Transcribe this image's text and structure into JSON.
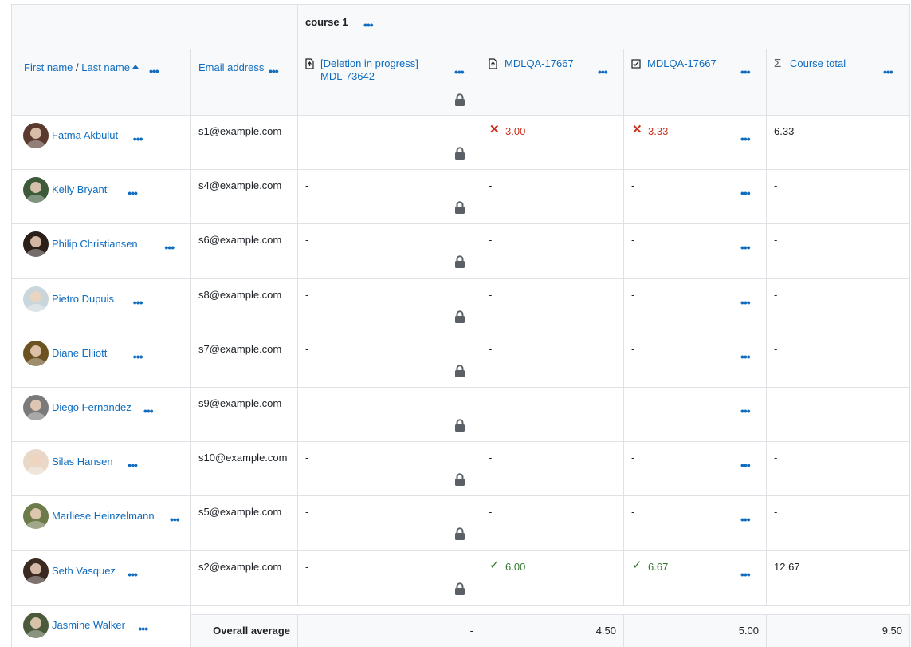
{
  "header": {
    "category_label": "course 1",
    "col_firstname": "First name",
    "name_separator": " / ",
    "col_lastname": "Last name",
    "col_email": "Email address",
    "col_item1_line1": "[Deletion in progress]",
    "col_item1_line2": "MDL-73642",
    "col_item2": "MDLQA-17667",
    "col_item3": "MDLQA-17667",
    "col_total": "Course total",
    "more_glyph": "•••"
  },
  "rows": [
    {
      "name": "Fatma Akbulut",
      "email": "s1@example.com",
      "item1": "-",
      "item2": "3.00",
      "item2_status": "incorrect",
      "item3": "3.33",
      "item3_status": "incorrect",
      "total": "6.33",
      "avatar_color": "#5a3a2e"
    },
    {
      "name": "Kelly Bryant",
      "email": "s4@example.com",
      "item1": "-",
      "item2": "-",
      "item2_status": "none",
      "item3": "-",
      "item3_status": "none",
      "total": "-",
      "avatar_color": "#3d5a3a"
    },
    {
      "name": "Philip Christiansen",
      "email": "s6@example.com",
      "item1": "-",
      "item2": "-",
      "item2_status": "none",
      "item3": "-",
      "item3_status": "none",
      "total": "-",
      "avatar_color": "#2b1f1a"
    },
    {
      "name": "Pietro Dupuis",
      "email": "s8@example.com",
      "item1": "-",
      "item2": "-",
      "item2_status": "none",
      "item3": "-",
      "item3_status": "none",
      "total": "-",
      "avatar_color": "#c9d6dc"
    },
    {
      "name": "Diane Elliott",
      "email": "s7@example.com",
      "item1": "-",
      "item2": "-",
      "item2_status": "none",
      "item3": "-",
      "item3_status": "none",
      "total": "-",
      "avatar_color": "#6b5220"
    },
    {
      "name": "Diego Fernandez",
      "email": "s9@example.com",
      "item1": "-",
      "item2": "-",
      "item2_status": "none",
      "item3": "-",
      "item3_status": "none",
      "total": "-",
      "avatar_color": "#7a7a7a"
    },
    {
      "name": "Silas Hansen",
      "email": "s10@example.com",
      "item1": "-",
      "item2": "-",
      "item2_status": "none",
      "item3": "-",
      "item3_status": "none",
      "total": "-",
      "avatar_color": "#e9d8c8"
    },
    {
      "name": "Marliese Heinzelmann",
      "email": "s5@example.com",
      "item1": "-",
      "item2": "-",
      "item2_status": "none",
      "item3": "-",
      "item3_status": "none",
      "total": "-",
      "avatar_color": "#6d7a4a"
    },
    {
      "name": "Seth Vasquez",
      "email": "s2@example.com",
      "item1": "-",
      "item2": "6.00",
      "item2_status": "correct",
      "item3": "6.67",
      "item3_status": "correct",
      "total": "12.67",
      "avatar_color": "#3a2a22"
    }
  ],
  "last_user": {
    "name": "Jasmine Walker",
    "avatar_color": "#4a5a3a"
  },
  "footer": {
    "label": "Overall average",
    "item1": "-",
    "item2": "4.50",
    "item3": "5.00",
    "total": "9.50"
  },
  "colors": {
    "link": "#0f6cbf",
    "incorrect": "#ca3120",
    "correct": "#357a32",
    "border": "#dee2e6",
    "header_bg": "#f8f9fa"
  }
}
